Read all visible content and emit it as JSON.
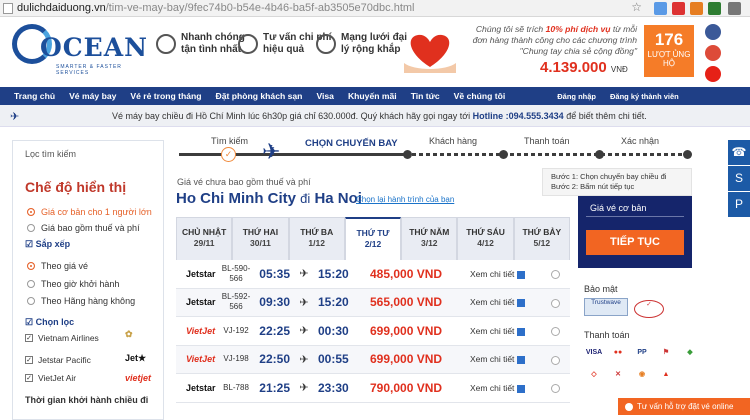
{
  "browser": {
    "host": "dulichdaiduong.vn",
    "path": "/tim-ve-may-bay/9fec74b0-b54e-4b46-ba5f-ab3505e70dbc.html"
  },
  "header": {
    "logo_text": "OCEAN",
    "logo_tagline": "SMARTER & FASTER SERVICES",
    "features": [
      {
        "icon": "clock-icon",
        "text": "Nhanh chóng tận tình nhất"
      },
      {
        "icon": "money-icon",
        "text": "Tư vấn chi phí hiệu quả"
      },
      {
        "icon": "network-icon",
        "text": "Mạng lưới đại lý rộng khắp"
      }
    ],
    "promo_line1": "Chúng tôi sẽ trích",
    "promo_highlight": "10% phí dịch vụ",
    "promo_line2": "từ mỗi đơn hàng thành công cho các chương trình \"Chung tay chia sẻ cộng đồng\"",
    "promo_amount": "4.139.000",
    "promo_currency": "VNĐ",
    "luot_count": "176",
    "luot_label": "LƯỢT ỦNG HỘ"
  },
  "nav": [
    "Trang chủ",
    "Vé máy bay",
    "Vé rẻ trong tháng",
    "Đặt phòng khách sạn",
    "Visa",
    "Khuyến mãi",
    "Tin tức",
    "Về chúng tôi",
    "Đăng nhập",
    "Đăng ký thành viên"
  ],
  "notice": {
    "text": "Vé máy bay chiều đi Hồ Chí Minh lúc 6h30p giá chỉ 630.000đ. Quý khách hãy gọi ngay tới",
    "hotline_label": "Hotline :094.555.3434",
    "text2": "để biết thêm chi tiết."
  },
  "sidebar": {
    "search_label": "Lọc tìm kiếm",
    "mode_title": "Chế độ hiển thị",
    "modes": [
      "Giá cơ bản cho 1 người lớn",
      "Giá bao gồm thuế và phí"
    ],
    "sort_title": "Sắp xếp",
    "sorts": [
      "Theo giá vé",
      "Theo giờ khởi hành",
      "Theo Hãng hàng không"
    ],
    "filter_title": "Chọn lọc",
    "airlines": [
      "Vietnam Airlines",
      "Jetstar Pacific",
      "VietJet Air"
    ],
    "time_title": "Thời gian khởi hành chiều đi"
  },
  "steps": {
    "search": "Tìm kiếm",
    "choose": "CHỌN CHUYẾN BAY",
    "customer": "Khách hàng",
    "pay": "Thanh toán",
    "confirm": "Xác nhận"
  },
  "price_note": "Giá vé chưa bao gồm thuế và phí",
  "route": {
    "from": "Ho Chi Minh City",
    "di": "đi",
    "to": "Ha Noi",
    "reselect": "Chọn lại hành trình của bạn"
  },
  "buoc": {
    "b1": "Bước 1: Chọn chuyến bay chiều đi",
    "b2": "Bước 2: Bấm nút tiếp tục"
  },
  "days": [
    {
      "name": "CHỦ NHẬT",
      "date": "29/11"
    },
    {
      "name": "THỨ HAI",
      "date": "30/11"
    },
    {
      "name": "THỨ BA",
      "date": "1/12"
    },
    {
      "name": "THỨ TƯ",
      "date": "2/12"
    },
    {
      "name": "THỨ NĂM",
      "date": "3/12"
    },
    {
      "name": "THỨ SÁU",
      "date": "4/12"
    },
    {
      "name": "THỨ BẢY",
      "date": "5/12"
    }
  ],
  "flights": [
    {
      "airline": "Jetstar",
      "code": "BL-590-566",
      "dep": "05:35",
      "arr": "15:20",
      "price": "485,000 VND",
      "detail": "Xem chi tiết"
    },
    {
      "airline": "Jetstar",
      "code": "BL-592-566",
      "dep": "09:30",
      "arr": "15:20",
      "price": "565,000 VND",
      "detail": "Xem chi tiết"
    },
    {
      "airline": "VietJet",
      "code": "VJ-192",
      "dep": "22:25",
      "arr": "00:30",
      "price": "699,000 VND",
      "detail": "Xem chi tiết"
    },
    {
      "airline": "VietJet",
      "code": "VJ-198",
      "dep": "22:50",
      "arr": "00:55",
      "price": "699,000 VND",
      "detail": "Xem chi tiết"
    },
    {
      "airline": "Jetstar",
      "code": "BL-788",
      "dep": "21:25",
      "arr": "23:30",
      "price": "790,000 VND",
      "detail": "Xem chi tiết"
    }
  ],
  "right_panel": {
    "base_price": "Giá vé cơ bản",
    "continue": "TIẾP TỤC",
    "security": "Bảo mật",
    "payment": "Thanh toán"
  },
  "chat": "Tư vấn hỗ trợ đặt vé online",
  "colors": {
    "navy": "#1f3f86",
    "orange": "#f26522",
    "red": "#e0301e"
  }
}
